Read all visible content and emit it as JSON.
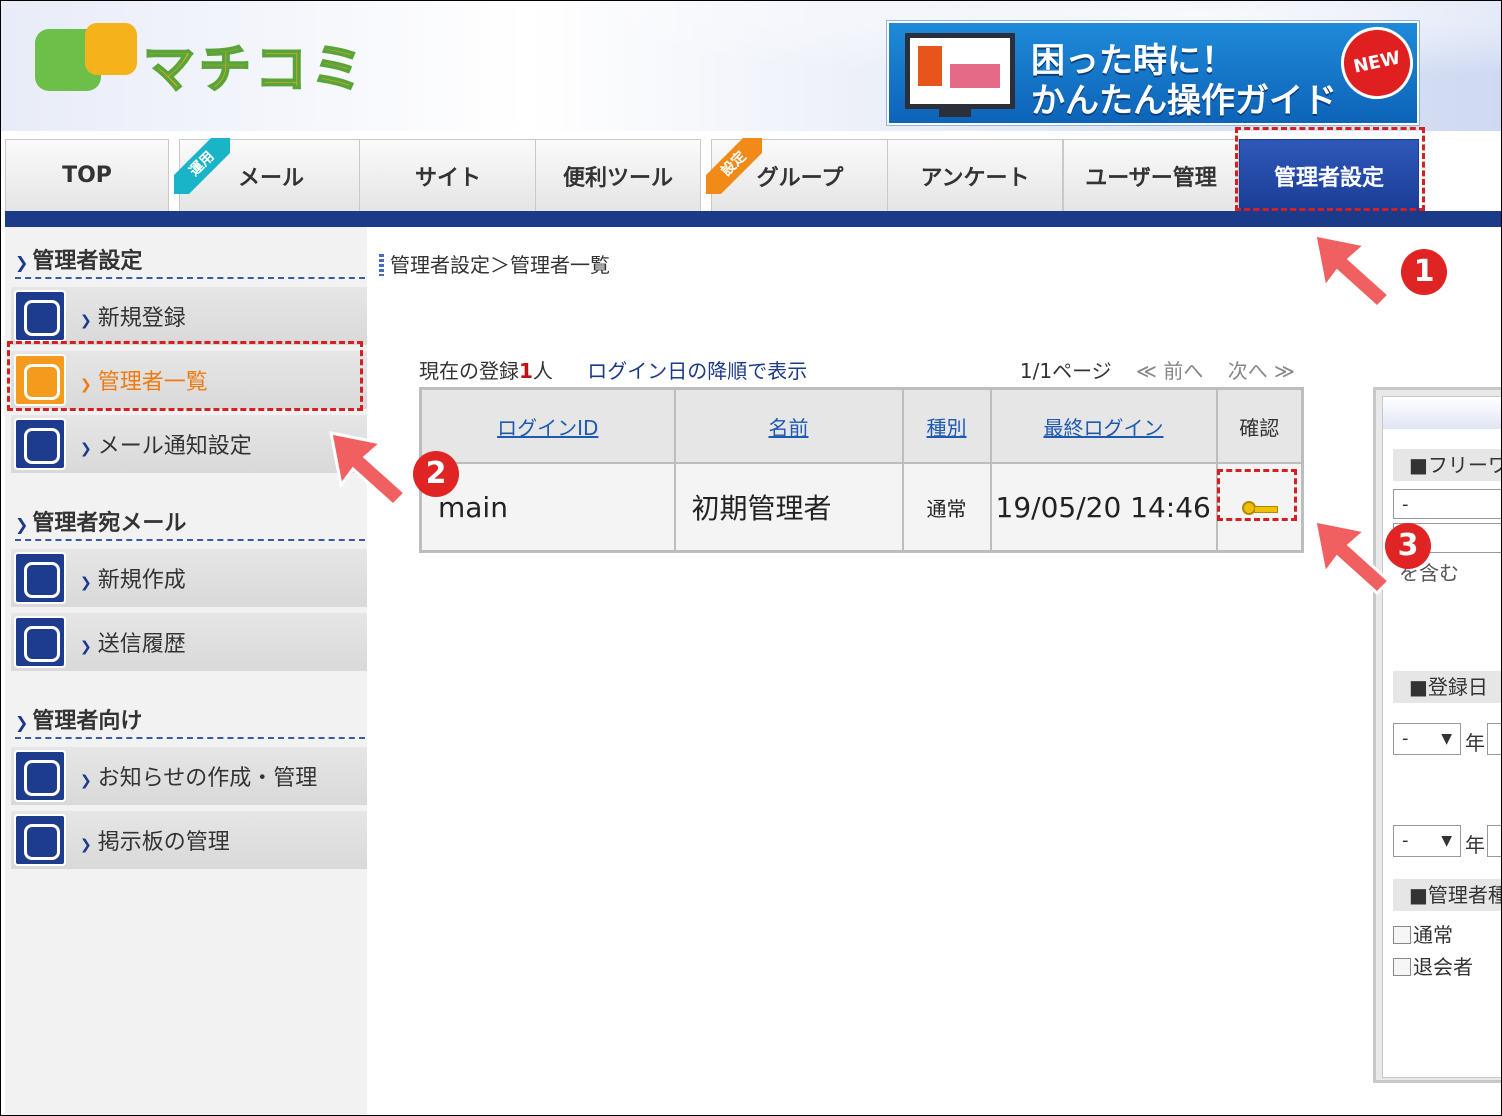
{
  "header": {
    "logo_text": "マチコミ",
    "banner_line1": "困った時に！",
    "banner_line2": "かんたん操作ガイド",
    "banner_badge": "NEW"
  },
  "nav": {
    "tabs": [
      {
        "label": "TOP"
      },
      {
        "label": "メール",
        "tag": "運用"
      },
      {
        "label": "サイト"
      },
      {
        "label": "便利ツール"
      },
      {
        "label": "グループ",
        "tag": "設定"
      },
      {
        "label": "アンケート"
      },
      {
        "label": "ユーザー管理"
      },
      {
        "label": "管理者設定",
        "active": true
      }
    ]
  },
  "sidebar": {
    "sections": [
      {
        "heading": "管理者設定",
        "items": [
          "新規登録",
          "管理者一覧",
          "メール通知設定"
        ]
      },
      {
        "heading": "管理者宛メール",
        "items": [
          "新規作成",
          "送信履歴"
        ]
      },
      {
        "heading": "管理者向け",
        "items": [
          "お知らせの作成・管理",
          "掲示板の管理"
        ]
      }
    ],
    "active_item": "管理者一覧"
  },
  "breadcrumb": "管理者設定＞管理者一覧",
  "listing": {
    "count_prefix": "現在の登録",
    "count": "1",
    "count_suffix": "人",
    "sort_text": "ログイン日の降順で表示",
    "page_info": "1/1ページ",
    "prev": "前へ",
    "next": "次へ"
  },
  "table": {
    "headers": [
      "ログインID",
      "名前",
      "種別",
      "最終ログイン",
      "確認"
    ],
    "rows": [
      {
        "login_id": "main",
        "name": "初期管理者",
        "type": "通常",
        "last_login": "19/05/20 14:46"
      }
    ]
  },
  "search": {
    "free_label": "■フリーワ",
    "free_value": "-",
    "include_text": "を含む",
    "reg_date_label": "■登録日",
    "select_value": "-",
    "year_label": "年",
    "admin_type_label": "■管理者種",
    "options": [
      "通常",
      "退会者"
    ]
  },
  "annotations": {
    "badge1": "1",
    "badge2": "2",
    "badge3": "3"
  },
  "colors": {
    "nav_active": "#1c3a8a",
    "annotation": "#d42020",
    "link": "#1e5ab0"
  }
}
